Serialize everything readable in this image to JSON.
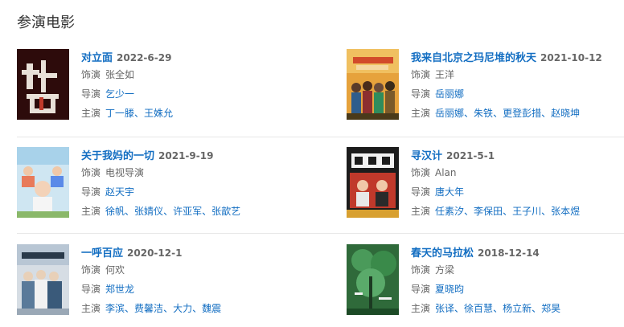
{
  "section": {
    "title": "参演电影"
  },
  "labels": {
    "role": "饰演",
    "director": "导演",
    "cast": "主演"
  },
  "separator": "、",
  "movies": [
    {
      "title": "对立面",
      "date": "2022-6-29",
      "role": "张全如",
      "directors": [
        "乞少一"
      ],
      "cast": [
        "丁一滕",
        "王姝允"
      ],
      "poster_icon": "poster-duilimian"
    },
    {
      "title": "我来自北京之玛尼堆的秋天",
      "date": "2021-10-12",
      "role": "王洋",
      "directors": [
        "岳丽娜"
      ],
      "cast": [
        "岳丽娜",
        "朱铁",
        "更登彭措",
        "赵晓坤"
      ],
      "poster_icon": "poster-autumn-of-mani"
    },
    {
      "title": "关于我妈的一切",
      "date": "2021-9-19",
      "role": "电视导演",
      "directors": [
        "赵天宇"
      ],
      "cast": [
        "徐帆",
        "张婧仪",
        "许亚军",
        "张歆艺"
      ],
      "poster_icon": "poster-mother"
    },
    {
      "title": "寻汉计",
      "date": "2021-5-1",
      "role": "Alan",
      "directors": [
        "唐大年"
      ],
      "cast": [
        "任素汐",
        "李保田",
        "王子川",
        "张本煜"
      ],
      "poster_icon": "poster-xunhanji"
    },
    {
      "title": "一呼百应",
      "date": "2020-12-1",
      "role": "何欢",
      "directors": [
        "郑世龙"
      ],
      "cast": [
        "李滨",
        "费馨洁",
        "大力",
        "魏震"
      ],
      "poster_icon": "poster-yihubaiying"
    },
    {
      "title": "春天的马拉松",
      "date": "2018-12-14",
      "role": "方梁",
      "directors": [
        "夏晓昀"
      ],
      "cast": [
        "张译",
        "徐百慧",
        "杨立新",
        "郑昊"
      ],
      "poster_icon": "poster-spring-marathon"
    }
  ]
}
